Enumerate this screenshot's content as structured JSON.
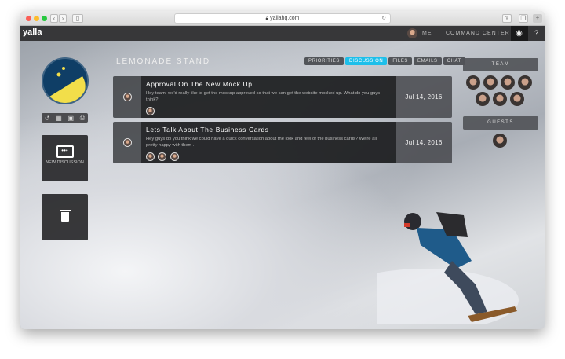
{
  "browser": {
    "url": "yallahq.com"
  },
  "topbar": {
    "logo": "yalla",
    "me_label": "ME",
    "command_center": "COMMAND CENTER"
  },
  "project": {
    "title": "LEMONADE STAND"
  },
  "tabs": [
    {
      "label": "PRIORITIES",
      "active": false
    },
    {
      "label": "DISCUSSION",
      "active": true
    },
    {
      "label": "FILES",
      "active": false
    },
    {
      "label": "EMAILS",
      "active": false
    },
    {
      "label": "CHAT",
      "active": false
    }
  ],
  "sidebar": {
    "new_discussion_label": "NEW DISCUSSION"
  },
  "discussions": [
    {
      "title": "Approval On The New Mock Up",
      "body": "Hey team, we'd really like to get the mockup approved so that we can get the website mocked up. What do you guys think?",
      "date": "Jul 14, 2016",
      "participants": 1
    },
    {
      "title": "Lets Talk About The Business Cards",
      "body": "Hey guys do you think we could have a quick conversation about the look and feel of the business cards? We're all pretty happy with them ..",
      "date": "Jul 14, 2016",
      "participants": 3
    }
  ],
  "team": {
    "title": "TEAM",
    "count": 7
  },
  "guests": {
    "title": "GUESTS",
    "count": 1
  },
  "colors": {
    "accent": "#1ebfea",
    "logo_bg": "#0f3e66",
    "lemon": "#f2de4a"
  }
}
